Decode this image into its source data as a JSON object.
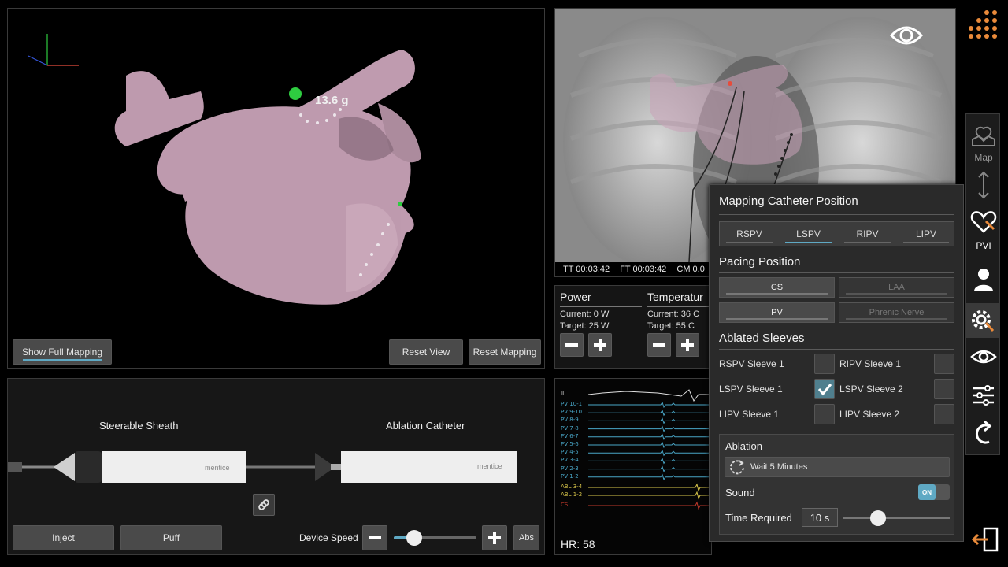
{
  "view3d": {
    "force_label": "13.6 g",
    "show_full_mapping": "Show Full Mapping",
    "reset_view": "Reset View",
    "reset_mapping": "Reset Mapping"
  },
  "fluoro": {
    "tt": "TT 00:03:42",
    "ft": "FT 00:03:42",
    "cm": "CM 0.0"
  },
  "devices": {
    "sheath_label": "Steerable Sheath",
    "catheter_label": "Ablation Catheter",
    "brand": "mentice",
    "inject": "Inject",
    "puff": "Puff",
    "device_speed_label": "Device Speed",
    "device_speed_value": 0.25,
    "abs": "Abs"
  },
  "power": {
    "title": "Power",
    "current": "Current: 0 W",
    "target": "Target: 25 W"
  },
  "temperature": {
    "title": "Temperatur",
    "current": "Current: 36 C",
    "target": "Target: 55 C"
  },
  "ecg": {
    "leads": [
      "II",
      "PV 10-1",
      "PV 9-10",
      "PV 8-9",
      "PV 7-8",
      "PV 6-7",
      "PV 5-6",
      "PV 4-5",
      "PV 3-4",
      "PV 2-3",
      "PV 1-2",
      "ABL 3-4",
      "ABL 1-2",
      "CS"
    ],
    "lead_colors": {
      "surface": "#e0e0e0",
      "pv": "#49a6c7",
      "abl": "#d9c64a",
      "cs": "#c0392b"
    },
    "hr": "HR: 58"
  },
  "popup": {
    "mapping_title": "Mapping Catheter Position",
    "positions": [
      {
        "label": "RSPV",
        "active": false
      },
      {
        "label": "LSPV",
        "active": true
      },
      {
        "label": "RIPV",
        "active": false
      },
      {
        "label": "LIPV",
        "active": false
      }
    ],
    "pacing_title": "Pacing Position",
    "pacing": {
      "cs": "CS",
      "laa": "LAA",
      "pv": "PV",
      "phrenic": "Phrenic Nerve"
    },
    "ablated_title": "Ablated Sleeves",
    "sleeves": {
      "rspv1": "RSPV Sleeve 1",
      "ripv1": "RIPV Sleeve 1",
      "lspv1": "LSPV Sleeve 1",
      "lspv2": "LSPV Sleeve 2",
      "lipv1": "LIPV Sleeve 1",
      "lipv2": "LIPV Sleeve 2"
    },
    "ablation_title": "Ablation",
    "wait": "Wait 5 Minutes",
    "sound_label": "Sound",
    "sound_state": "ON",
    "time_label": "Time Required",
    "time_value": "10 s",
    "time_slider_value": 0.33
  },
  "sidebar": {
    "map": "Map",
    "pvi": "PVI"
  },
  "colors": {
    "accent": "#5fa9c4",
    "heart": "#c9a3b8",
    "brand_orange": "#e98a3a"
  }
}
